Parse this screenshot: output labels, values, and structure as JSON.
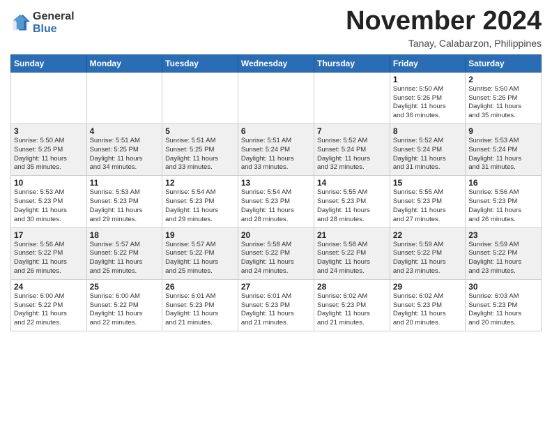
{
  "header": {
    "logo_general": "General",
    "logo_blue": "Blue",
    "month_title": "November 2024",
    "location": "Tanay, Calabarzon, Philippines"
  },
  "weekdays": [
    "Sunday",
    "Monday",
    "Tuesday",
    "Wednesday",
    "Thursday",
    "Friday",
    "Saturday"
  ],
  "weeks": [
    [
      {
        "day": "",
        "info": ""
      },
      {
        "day": "",
        "info": ""
      },
      {
        "day": "",
        "info": ""
      },
      {
        "day": "",
        "info": ""
      },
      {
        "day": "",
        "info": ""
      },
      {
        "day": "1",
        "info": "Sunrise: 5:50 AM\nSunset: 5:26 PM\nDaylight: 11 hours\nand 36 minutes."
      },
      {
        "day": "2",
        "info": "Sunrise: 5:50 AM\nSunset: 5:26 PM\nDaylight: 11 hours\nand 35 minutes."
      }
    ],
    [
      {
        "day": "3",
        "info": "Sunrise: 5:50 AM\nSunset: 5:25 PM\nDaylight: 11 hours\nand 35 minutes."
      },
      {
        "day": "4",
        "info": "Sunrise: 5:51 AM\nSunset: 5:25 PM\nDaylight: 11 hours\nand 34 minutes."
      },
      {
        "day": "5",
        "info": "Sunrise: 5:51 AM\nSunset: 5:25 PM\nDaylight: 11 hours\nand 33 minutes."
      },
      {
        "day": "6",
        "info": "Sunrise: 5:51 AM\nSunset: 5:24 PM\nDaylight: 11 hours\nand 33 minutes."
      },
      {
        "day": "7",
        "info": "Sunrise: 5:52 AM\nSunset: 5:24 PM\nDaylight: 11 hours\nand 32 minutes."
      },
      {
        "day": "8",
        "info": "Sunrise: 5:52 AM\nSunset: 5:24 PM\nDaylight: 11 hours\nand 31 minutes."
      },
      {
        "day": "9",
        "info": "Sunrise: 5:53 AM\nSunset: 5:24 PM\nDaylight: 11 hours\nand 31 minutes."
      }
    ],
    [
      {
        "day": "10",
        "info": "Sunrise: 5:53 AM\nSunset: 5:23 PM\nDaylight: 11 hours\nand 30 minutes."
      },
      {
        "day": "11",
        "info": "Sunrise: 5:53 AM\nSunset: 5:23 PM\nDaylight: 11 hours\nand 29 minutes."
      },
      {
        "day": "12",
        "info": "Sunrise: 5:54 AM\nSunset: 5:23 PM\nDaylight: 11 hours\nand 29 minutes."
      },
      {
        "day": "13",
        "info": "Sunrise: 5:54 AM\nSunset: 5:23 PM\nDaylight: 11 hours\nand 28 minutes."
      },
      {
        "day": "14",
        "info": "Sunrise: 5:55 AM\nSunset: 5:23 PM\nDaylight: 11 hours\nand 28 minutes."
      },
      {
        "day": "15",
        "info": "Sunrise: 5:55 AM\nSunset: 5:23 PM\nDaylight: 11 hours\nand 27 minutes."
      },
      {
        "day": "16",
        "info": "Sunrise: 5:56 AM\nSunset: 5:23 PM\nDaylight: 11 hours\nand 26 minutes."
      }
    ],
    [
      {
        "day": "17",
        "info": "Sunrise: 5:56 AM\nSunset: 5:22 PM\nDaylight: 11 hours\nand 26 minutes."
      },
      {
        "day": "18",
        "info": "Sunrise: 5:57 AM\nSunset: 5:22 PM\nDaylight: 11 hours\nand 25 minutes."
      },
      {
        "day": "19",
        "info": "Sunrise: 5:57 AM\nSunset: 5:22 PM\nDaylight: 11 hours\nand 25 minutes."
      },
      {
        "day": "20",
        "info": "Sunrise: 5:58 AM\nSunset: 5:22 PM\nDaylight: 11 hours\nand 24 minutes."
      },
      {
        "day": "21",
        "info": "Sunrise: 5:58 AM\nSunset: 5:22 PM\nDaylight: 11 hours\nand 24 minutes."
      },
      {
        "day": "22",
        "info": "Sunrise: 5:59 AM\nSunset: 5:22 PM\nDaylight: 11 hours\nand 23 minutes."
      },
      {
        "day": "23",
        "info": "Sunrise: 5:59 AM\nSunset: 5:22 PM\nDaylight: 11 hours\nand 23 minutes."
      }
    ],
    [
      {
        "day": "24",
        "info": "Sunrise: 6:00 AM\nSunset: 5:22 PM\nDaylight: 11 hours\nand 22 minutes."
      },
      {
        "day": "25",
        "info": "Sunrise: 6:00 AM\nSunset: 5:22 PM\nDaylight: 11 hours\nand 22 minutes."
      },
      {
        "day": "26",
        "info": "Sunrise: 6:01 AM\nSunset: 5:23 PM\nDaylight: 11 hours\nand 21 minutes."
      },
      {
        "day": "27",
        "info": "Sunrise: 6:01 AM\nSunset: 5:23 PM\nDaylight: 11 hours\nand 21 minutes."
      },
      {
        "day": "28",
        "info": "Sunrise: 6:02 AM\nSunset: 5:23 PM\nDaylight: 11 hours\nand 21 minutes."
      },
      {
        "day": "29",
        "info": "Sunrise: 6:02 AM\nSunset: 5:23 PM\nDaylight: 11 hours\nand 20 minutes."
      },
      {
        "day": "30",
        "info": "Sunrise: 6:03 AM\nSunset: 5:23 PM\nDaylight: 11 hours\nand 20 minutes."
      }
    ]
  ]
}
